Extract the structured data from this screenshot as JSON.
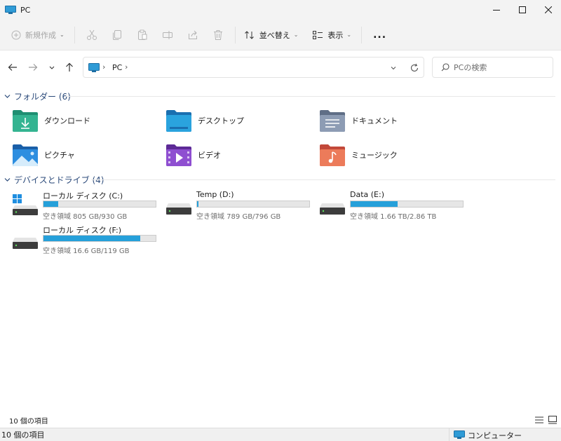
{
  "window": {
    "title": "PC"
  },
  "toolbar": {
    "new_label": "新規作成",
    "sort_label": "並べ替え",
    "view_label": "表示",
    "more_label": "..."
  },
  "address": {
    "location": "PC"
  },
  "search": {
    "placeholder": "PCの検索"
  },
  "folders_section": {
    "label": "フォルダー (6)"
  },
  "folders": [
    {
      "name": "ダウンロード",
      "icon": "downloads-folder-icon",
      "color": "#2fa98c"
    },
    {
      "name": "デスクトップ",
      "icon": "desktop-folder-icon",
      "color": "#2a9fd8"
    },
    {
      "name": "ドキュメント",
      "icon": "documents-folder-icon",
      "color": "#7f8fa6"
    },
    {
      "name": "ピクチャ",
      "icon": "pictures-folder-icon",
      "color": "#2a8ad4"
    },
    {
      "name": "ビデオ",
      "icon": "videos-folder-icon",
      "color": "#8a45c9"
    },
    {
      "name": "ミュージック",
      "icon": "music-folder-icon",
      "color": "#e0674f"
    }
  ],
  "drives_section": {
    "label": "デバイスとドライブ (4)"
  },
  "drives": [
    {
      "name": "ローカル ディスク (C:)",
      "free_text": "空き領域 805 GB/930 GB",
      "used_fraction": 0.13,
      "system": true
    },
    {
      "name": "Temp (D:)",
      "free_text": "空き領域 789 GB/796 GB",
      "used_fraction": 0.01,
      "system": false
    },
    {
      "name": "Data (E:)",
      "free_text": "空き領域 1.66 TB/2.86 TB",
      "used_fraction": 0.42,
      "system": false
    },
    {
      "name": "ローカル ディスク (F:)",
      "free_text": "空き領域 16.6 GB/119 GB",
      "used_fraction": 0.86,
      "system": false
    }
  ],
  "status": {
    "item_count": "10 個の項目",
    "bottom_count": "10 個の項目",
    "computer_label": "コンピューター"
  },
  "colors": {
    "accent": "#26a0da",
    "section_header": "#2b4a7a"
  }
}
